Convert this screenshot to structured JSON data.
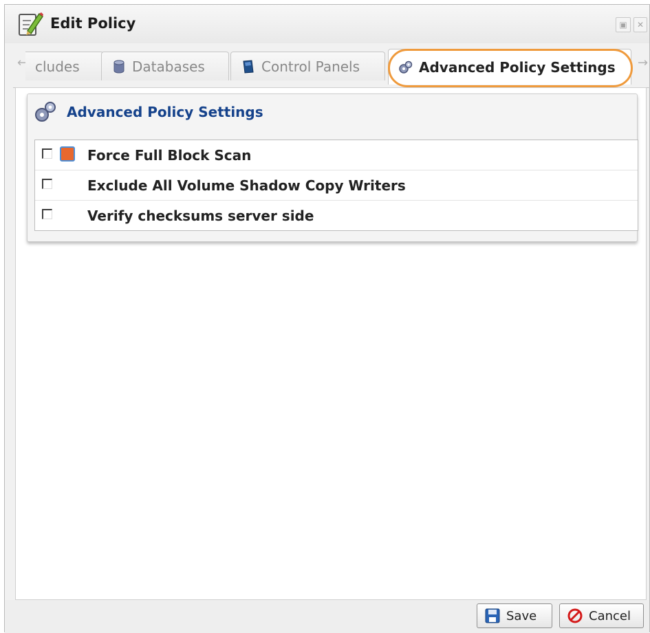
{
  "window": {
    "title": "Edit Policy",
    "maximize_glyph": "▣",
    "close_glyph": "✕"
  },
  "tabs": {
    "scroll_left_glyph": "←",
    "scroll_right_glyph": "→",
    "items": [
      {
        "label": "cludes",
        "icon": "none"
      },
      {
        "label": "Databases",
        "icon": "database-icon"
      },
      {
        "label": "Control Panels",
        "icon": "control-panel-icon"
      },
      {
        "label": "Advanced Policy Settings",
        "icon": "gears-icon",
        "active": true
      }
    ]
  },
  "panel": {
    "title": "Advanced Policy Settings",
    "icon": "gears-icon",
    "options": [
      {
        "label": "Force Full Block Scan",
        "checked": false,
        "icon": "orange-square-icon"
      },
      {
        "label": "Exclude All Volume Shadow Copy Writers",
        "checked": false
      },
      {
        "label": "Verify checksums server side",
        "checked": false
      }
    ]
  },
  "footer": {
    "save_label": "Save",
    "cancel_label": "Cancel"
  },
  "colors": {
    "accent_title": "#15428b",
    "highlight_ring": "#ef9a3c",
    "option_icon_fill": "#e8682e",
    "option_icon_border": "#4d8ed6"
  }
}
